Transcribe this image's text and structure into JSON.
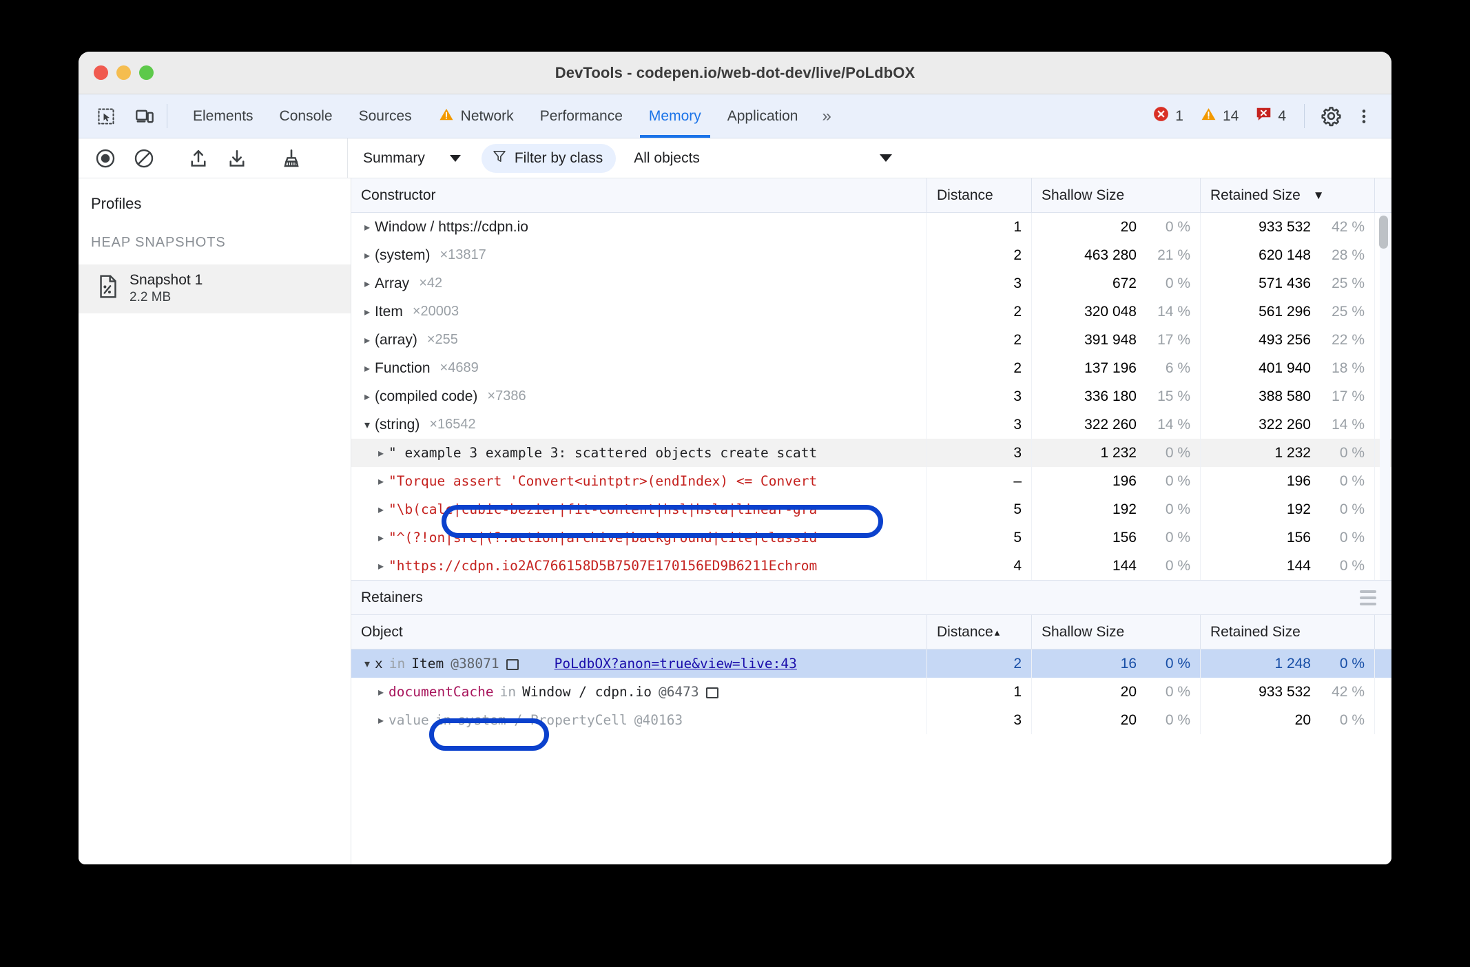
{
  "window": {
    "title": "DevTools - codepen.io/web-dot-dev/live/PoLdbOX",
    "traffic_lights": [
      "close",
      "minimize",
      "maximize"
    ]
  },
  "tabstrip": {
    "left_icons": [
      "inspect-element-icon",
      "device-toolbar-icon"
    ],
    "tabs": [
      {
        "label": "Elements",
        "active": false
      },
      {
        "label": "Console",
        "active": false
      },
      {
        "label": "Sources",
        "active": false
      },
      {
        "label": "Network",
        "active": false,
        "icon": "warning-triangle-icon"
      },
      {
        "label": "Performance",
        "active": false
      },
      {
        "label": "Memory",
        "active": true
      },
      {
        "label": "Application",
        "active": false
      }
    ],
    "more_tabs_label": "»",
    "badges": [
      {
        "name": "errors",
        "icon": "error-circle-icon",
        "count": "1",
        "color": "#d93025"
      },
      {
        "name": "warnings",
        "icon": "warning-triangle-icon",
        "count": "14",
        "color": "#f29900"
      },
      {
        "name": "issues",
        "icon": "issue-speech-icon",
        "count": "4",
        "color": "#c5221f"
      }
    ],
    "settings_icon": "gear-icon",
    "more_options_icon": "kebab-menu-icon"
  },
  "memory_toolbar": {
    "buttons": [
      {
        "name": "record-heap-snapshot",
        "icon": "record-circle-icon"
      },
      {
        "name": "clear-profiles",
        "icon": "clear-prohibited-icon"
      },
      {
        "name": "load-profile",
        "icon": "upload-arrow-icon"
      },
      {
        "name": "save-profile",
        "icon": "download-arrow-icon"
      },
      {
        "name": "collect-garbage",
        "icon": "broom-icon"
      }
    ],
    "view_select": "Summary",
    "filter_pill": {
      "icon": "funnel-filter-icon",
      "label": "Filter by class"
    },
    "class_filter_select": "All objects"
  },
  "sidebar": {
    "title": "Profiles",
    "section_label": "HEAP SNAPSHOTS",
    "items": [
      {
        "icon": "snapshot-file-icon",
        "name": "Snapshot 1",
        "size": "2.2 MB",
        "selected": true
      }
    ]
  },
  "constructor_grid": {
    "columns": [
      "Constructor",
      "Distance",
      "Shallow Size",
      "Retained Size"
    ],
    "sorted_column": "Retained Size",
    "sort_direction": "desc",
    "sort_glyph": "▼",
    "rows": [
      {
        "expander": "▸",
        "name": "Window / https://cdpn.io",
        "count": "",
        "distance": "1",
        "shallow": "20",
        "shallow_pct": "0 %",
        "retained": "933 532",
        "retained_pct": "42 %",
        "style": "plain",
        "indent": 0
      },
      {
        "expander": "▸",
        "name": "(system)",
        "count": "×13817",
        "distance": "2",
        "shallow": "463 280",
        "shallow_pct": "21 %",
        "retained": "620 148",
        "retained_pct": "28 %",
        "style": "plain",
        "indent": 0
      },
      {
        "expander": "▸",
        "name": "Array",
        "count": "×42",
        "distance": "3",
        "shallow": "672",
        "shallow_pct": "0 %",
        "retained": "571 436",
        "retained_pct": "25 %",
        "style": "plain",
        "indent": 0
      },
      {
        "expander": "▸",
        "name": "Item",
        "count": "×20003",
        "distance": "2",
        "shallow": "320 048",
        "shallow_pct": "14 %",
        "retained": "561 296",
        "retained_pct": "25 %",
        "style": "plain",
        "indent": 0
      },
      {
        "expander": "▸",
        "name": "(array)",
        "count": "×255",
        "distance": "2",
        "shallow": "391 948",
        "shallow_pct": "17 %",
        "retained": "493 256",
        "retained_pct": "22 %",
        "style": "plain",
        "indent": 0
      },
      {
        "expander": "▸",
        "name": "Function",
        "count": "×4689",
        "distance": "2",
        "shallow": "137 196",
        "shallow_pct": "6 %",
        "retained": "401 940",
        "retained_pct": "18 %",
        "style": "plain",
        "indent": 0
      },
      {
        "expander": "▸",
        "name": "(compiled code)",
        "count": "×7386",
        "distance": "3",
        "shallow": "336 180",
        "shallow_pct": "15 %",
        "retained": "388 580",
        "retained_pct": "17 %",
        "style": "plain",
        "indent": 0
      },
      {
        "expander": "▾",
        "name": "(string)",
        "count": "×16542",
        "distance": "3",
        "shallow": "322 260",
        "shallow_pct": "14 %",
        "retained": "322 260",
        "retained_pct": "14 %",
        "style": "plain",
        "indent": 0
      },
      {
        "expander": "▸",
        "name": "\" example 3 example 3: scattered objects create scatt",
        "count": "",
        "distance": "3",
        "shallow": "1 232",
        "shallow_pct": "0 %",
        "retained": "1 232",
        "retained_pct": "0 %",
        "style": "string-selected",
        "indent": 1
      },
      {
        "expander": "▸",
        "name": "\"Torque assert 'Convert<uintptr>(endIndex) <= Convert",
        "count": "",
        "distance": "–",
        "shallow": "196",
        "shallow_pct": "0 %",
        "retained": "196",
        "retained_pct": "0 %",
        "style": "string",
        "indent": 1
      },
      {
        "expander": "▸",
        "name": "\"\\b(calc|cubic-bezier|fit-content|hsl|hsla|linear-gra",
        "count": "",
        "distance": "5",
        "shallow": "192",
        "shallow_pct": "0 %",
        "retained": "192",
        "retained_pct": "0 %",
        "style": "string",
        "indent": 1
      },
      {
        "expander": "▸",
        "name": "\"^(?!on|src|(?:action|archive|background|cite|classid",
        "count": "",
        "distance": "5",
        "shallow": "156",
        "shallow_pct": "0 %",
        "retained": "156",
        "retained_pct": "0 %",
        "style": "string",
        "indent": 1
      },
      {
        "expander": "▸",
        "name": "\"https://cdpn.io2AC766158D5B7507E170156ED9B6211Echrom",
        "count": "",
        "distance": "4",
        "shallow": "144",
        "shallow_pct": "0 %",
        "retained": "144",
        "retained_pct": "0 %",
        "style": "string",
        "indent": 1
      }
    ]
  },
  "retainers": {
    "panel_title": "Retainers",
    "menu_icon": "hamburger-menu-icon",
    "columns": [
      "Object",
      "Distance",
      "Shallow Size",
      "Retained Size"
    ],
    "sorted_column": "Distance",
    "sort_direction": "asc",
    "sort_glyph": "▴",
    "rows": [
      {
        "expander": "▾",
        "prop": "x",
        "in_word": "in",
        "owner": "Item",
        "id": "@38071",
        "has_box_glyph": true,
        "link": "PoLdbOX?anon=true&view=live:43",
        "distance": "2",
        "shallow": "16",
        "shallow_pct": "0 %",
        "retained": "1 248",
        "retained_pct": "0 %",
        "selected": true,
        "indent": 0,
        "style": "dark"
      },
      {
        "expander": "▸",
        "prop": "documentCache",
        "in_word": "in",
        "owner": "Window / cdpn.io",
        "id": "@6473",
        "has_box_glyph": true,
        "link": "",
        "distance": "1",
        "shallow": "20",
        "shallow_pct": "0 %",
        "retained": "933 532",
        "retained_pct": "42 %",
        "selected": false,
        "indent": 1,
        "style": "crimson"
      },
      {
        "expander": "▸",
        "prop": "value",
        "in_word": "in",
        "owner": "system / PropertyCell",
        "id": "@40163",
        "has_box_glyph": false,
        "link": "",
        "distance": "3",
        "shallow": "20",
        "shallow_pct": "0 %",
        "retained": "20",
        "retained_pct": "0 %",
        "selected": false,
        "indent": 1,
        "style": "muted"
      }
    ]
  },
  "annotations": {
    "accent_color": "#0b41cd",
    "ovals": [
      {
        "name": "highlight-selected-string-row"
      },
      {
        "name": "highlight-retainer-root-row"
      }
    ]
  }
}
